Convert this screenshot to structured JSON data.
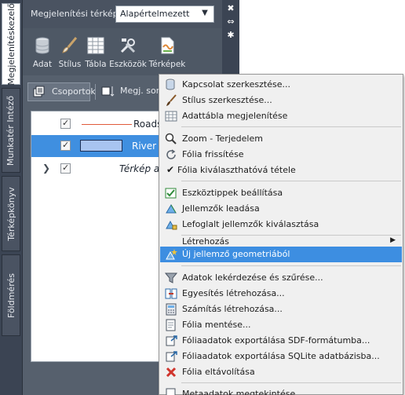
{
  "sidebar_tabs": [
    {
      "label": "Megjelenítéskezelő",
      "active": true
    },
    {
      "label": "Munkatér Intéző",
      "active": false
    },
    {
      "label": "Térképkönyv",
      "active": false
    },
    {
      "label": "Földmérés",
      "active": false
    }
  ],
  "header": {
    "map_label": "Megjelenítési térkép:",
    "map_value": "Alapértelmezett"
  },
  "ribbon": [
    {
      "label": "Adat",
      "icon": "database-icon"
    },
    {
      "label": "Stílus",
      "icon": "brush-icon"
    },
    {
      "label": "Tábla",
      "icon": "table-icon"
    },
    {
      "label": "Eszközök",
      "icon": "tools-icon"
    },
    {
      "label": "Térképek",
      "icon": "maps-icon"
    }
  ],
  "toolbar": {
    "groups_label": "Csoportok",
    "legend_label": "Megj. sorr"
  },
  "layers": [
    {
      "name": "Roads",
      "selected": false,
      "line_color": "#e05a3a"
    },
    {
      "name": "River",
      "selected": true,
      "swatch_color": "#a8c4f0"
    },
    {
      "name": "Térkép ala",
      "selected": false
    }
  ],
  "menu": {
    "items": [
      {
        "label": "Kapcsolat szerkesztése...",
        "icon": "database-edit-icon"
      },
      {
        "label": "Stílus szerkesztése...",
        "icon": "brush-icon"
      },
      {
        "label": "Adattábla megjelenítése",
        "icon": "table-icon"
      },
      {
        "label": "Zoom - Terjedelem",
        "icon": "zoom-icon"
      },
      {
        "label": "Fólia frissítése",
        "icon": "refresh-icon"
      },
      {
        "label": "Fólia kiválaszthatóvá tétele",
        "icon": "check-icon"
      },
      {
        "label": "Eszköztippek beállítása",
        "icon": "tooltip-icon"
      },
      {
        "label": "Jellemzők leadása",
        "icon": "release-features-icon"
      },
      {
        "label": "Lefoglalt jellemzők kiválasztása",
        "icon": "select-locked-icon"
      },
      {
        "label": "Létrehozás",
        "icon": "none"
      },
      {
        "label": "Új jellemző geometriából",
        "icon": "new-feature-icon"
      },
      {
        "label": "Adatok lekérdezése és szűrése...",
        "icon": "filter-icon"
      },
      {
        "label": "Egyesítés létrehozása...",
        "icon": "join-icon"
      },
      {
        "label": "Számítás létrehozása...",
        "icon": "calculator-icon"
      },
      {
        "label": "Fólia mentése...",
        "icon": "save-icon"
      },
      {
        "label": "Fóliaadatok exportálása SDF-formátumba...",
        "icon": "export-sdf-icon"
      },
      {
        "label": "Fóliaadatok exportálása SQLite adatbázisba...",
        "icon": "export-sqlite-icon"
      },
      {
        "label": "Fólia eltávolítása",
        "icon": "remove-icon"
      },
      {
        "label": "Metaadatok megtekintése...",
        "icon": "metadata-icon"
      }
    ]
  },
  "colors": {
    "panel_bg": "#56606d",
    "highlight": "#3d8ee1",
    "menu_bg": "#f0f0f0"
  }
}
